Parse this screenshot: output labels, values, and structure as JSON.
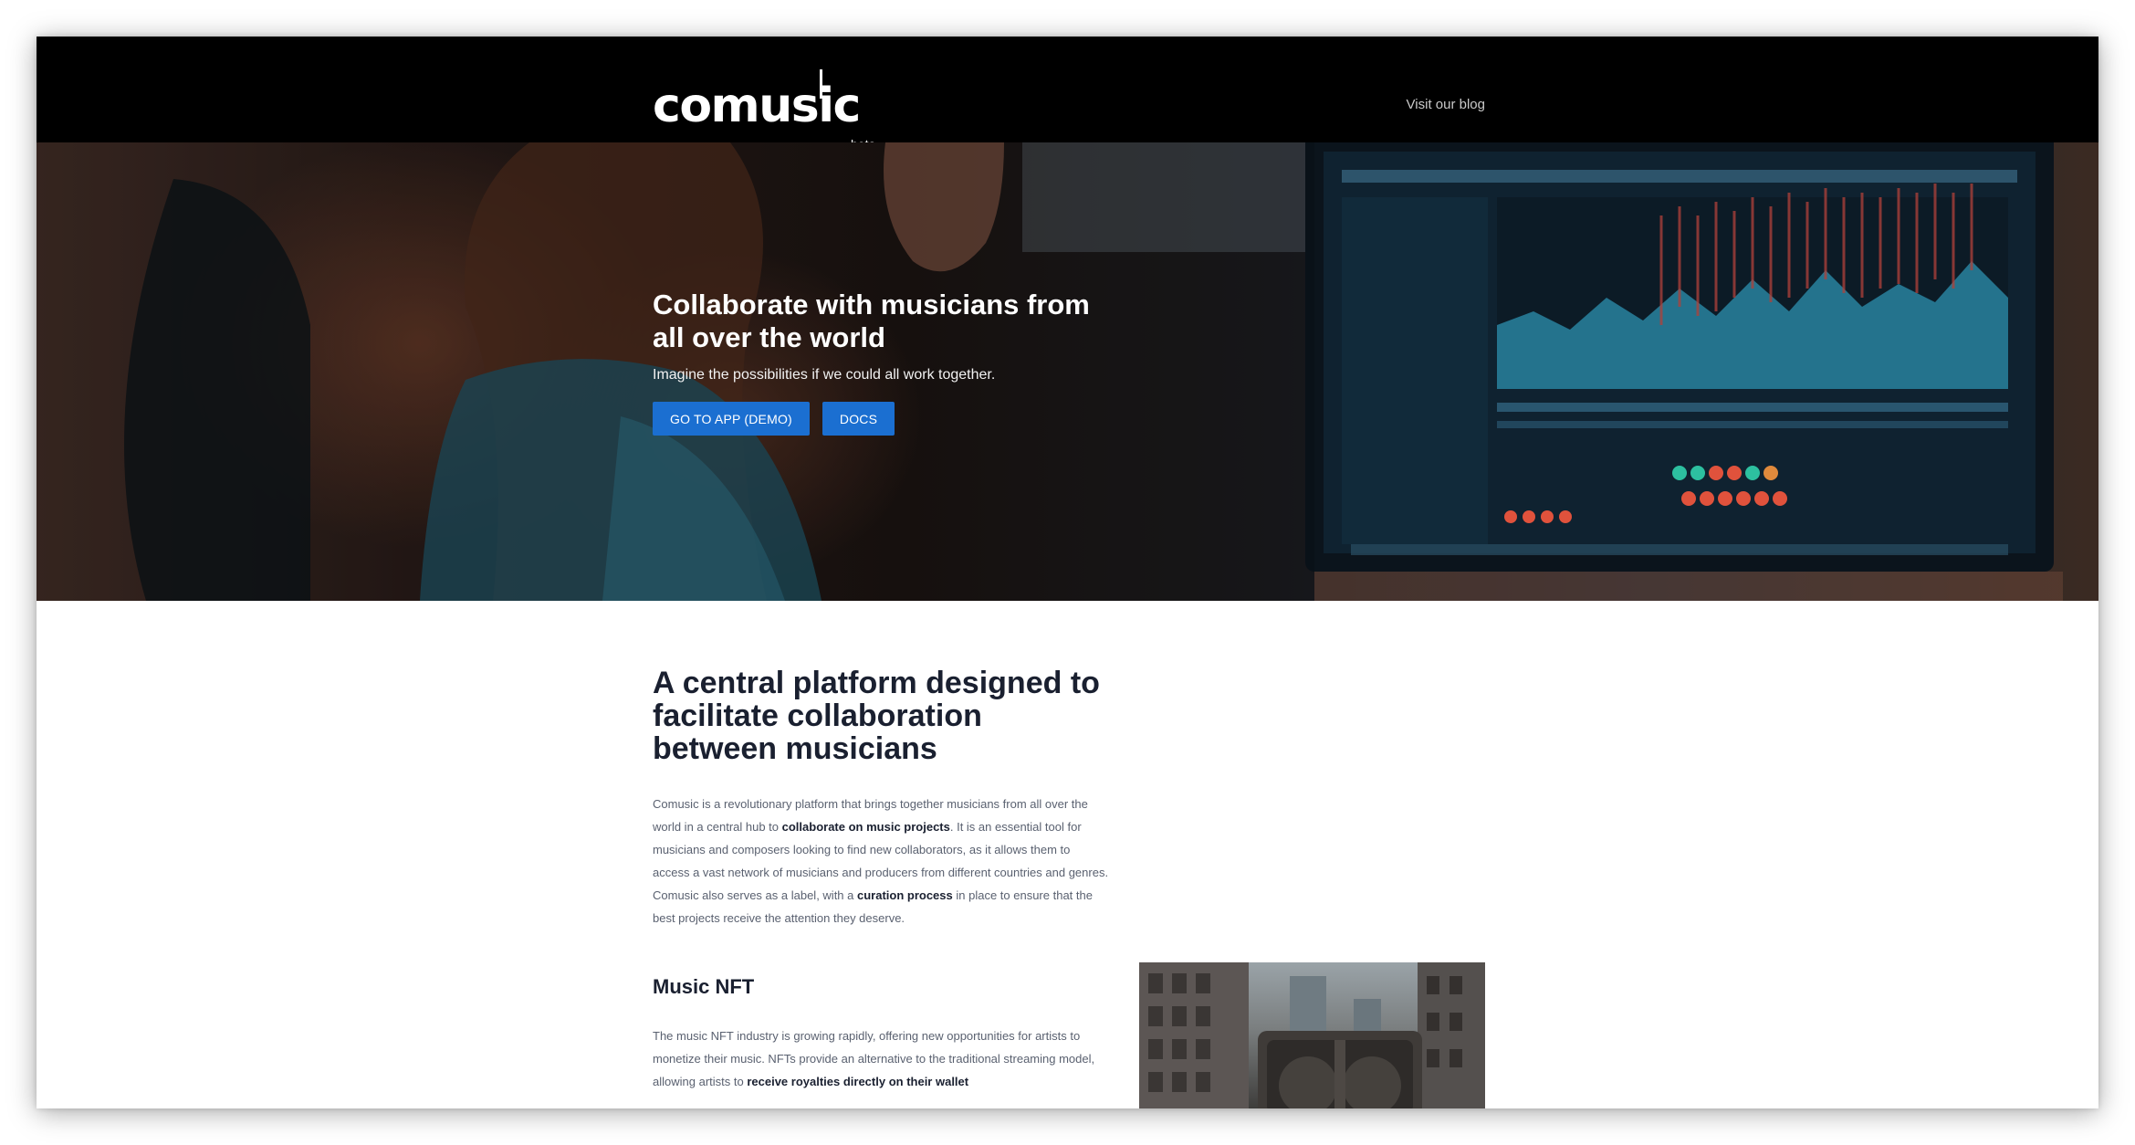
{
  "header": {
    "logo_text": "comusic",
    "logo_badge": "beta",
    "blog_link": "Visit our blog"
  },
  "hero": {
    "title": "Collaborate with musicians from all over the world",
    "subtitle": "Imagine the possibilities if we could all work together.",
    "buttons": {
      "app": "GO TO APP (DEMO)",
      "docs": "DOCS"
    }
  },
  "intro": {
    "heading": "A central platform designed to facilitate collaboration between musicians",
    "paragraph": [
      {
        "text": "Comusic is a revolutionary platform that brings together musicians from all over the world in a central hub to ",
        "bold": false
      },
      {
        "text": "collaborate on music projects",
        "bold": true
      },
      {
        "text": ". It is an essential tool for musicians and composers looking to find new collaborators, as it allows them to access a vast network of musicians and producers from different countries and genres. Comusic also serves as a label, with a ",
        "bold": false
      },
      {
        "text": "curation process",
        "bold": true
      },
      {
        "text": " in place to ensure that the best projects receive the attention they deserve.",
        "bold": false
      }
    ]
  },
  "nft": {
    "heading": "Music NFT",
    "paragraph": [
      {
        "text": "The music NFT industry is growing rapidly, offering new opportunities for artists to monetize their music. NFTs provide an alternative to the traditional streaming model, allowing artists to ",
        "bold": false
      },
      {
        "text": "receive royalties directly on their wallet",
        "bold": true
      }
    ]
  },
  "colors": {
    "header_bg": "#000000",
    "button_bg": "#1b6fd1",
    "heading_text": "#1a2030",
    "body_text": "#5a6170"
  }
}
